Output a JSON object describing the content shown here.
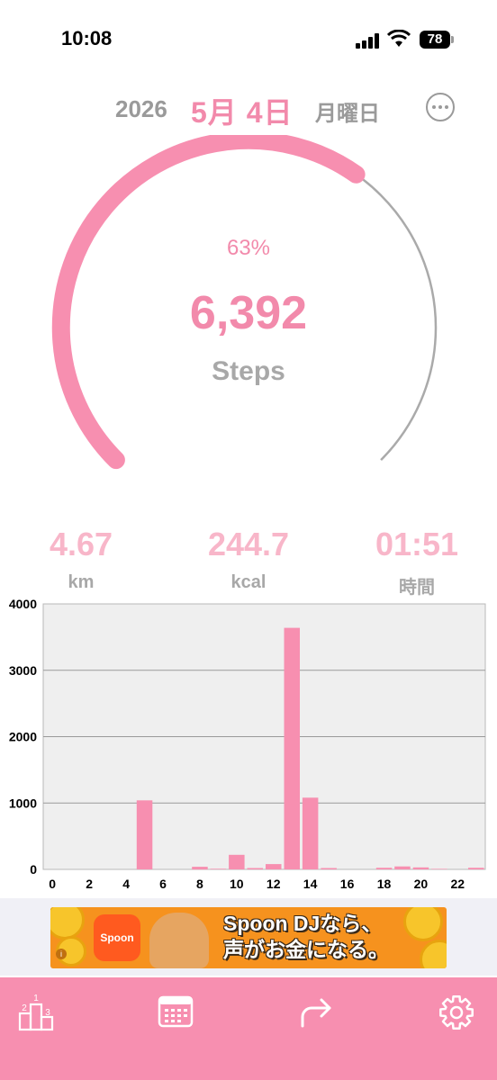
{
  "status": {
    "time": "10:08",
    "battery": "78"
  },
  "header": {
    "year": "2026",
    "month_day": "5月 4日",
    "weekday": "月曜日",
    "more_icon": "more-circle-icon"
  },
  "progress": {
    "percent_label": "63%",
    "fraction": 0.63,
    "steps": "6,392",
    "steps_label": "Steps"
  },
  "stats": [
    {
      "value": "4.67",
      "unit": "km"
    },
    {
      "value": "244.7",
      "unit": "kcal"
    },
    {
      "value": "01:51",
      "unit": "時間"
    }
  ],
  "chart_data": {
    "type": "bar",
    "x": [
      0,
      1,
      2,
      3,
      4,
      5,
      6,
      7,
      8,
      9,
      10,
      11,
      12,
      13,
      14,
      15,
      16,
      17,
      18,
      19,
      20,
      21,
      22,
      23
    ],
    "values": [
      0,
      0,
      0,
      0,
      0,
      1040,
      0,
      0,
      40,
      10,
      220,
      20,
      80,
      3640,
      1080,
      20,
      0,
      0,
      25,
      45,
      30,
      8,
      0,
      25
    ],
    "xticks": [
      "0",
      "2",
      "4",
      "6",
      "8",
      "10",
      "12",
      "14",
      "16",
      "18",
      "20",
      "22"
    ],
    "yticks": [
      "0",
      "1000",
      "2000",
      "3000",
      "4000"
    ],
    "ylim": [
      0,
      4000
    ],
    "grid": true
  },
  "ad": {
    "brand": "Spoon",
    "line1": "Spoon DJなら、",
    "line2": "声がお金になる。",
    "info": "i"
  },
  "tabbar": {
    "icons": [
      "ranking-podium-icon",
      "calendar-icon",
      "share-icon",
      "settings-gear-icon"
    ]
  },
  "colors": {
    "accent": "#f78fb0",
    "text_pink": "#f28aab",
    "gray": "#a8a8a8"
  }
}
